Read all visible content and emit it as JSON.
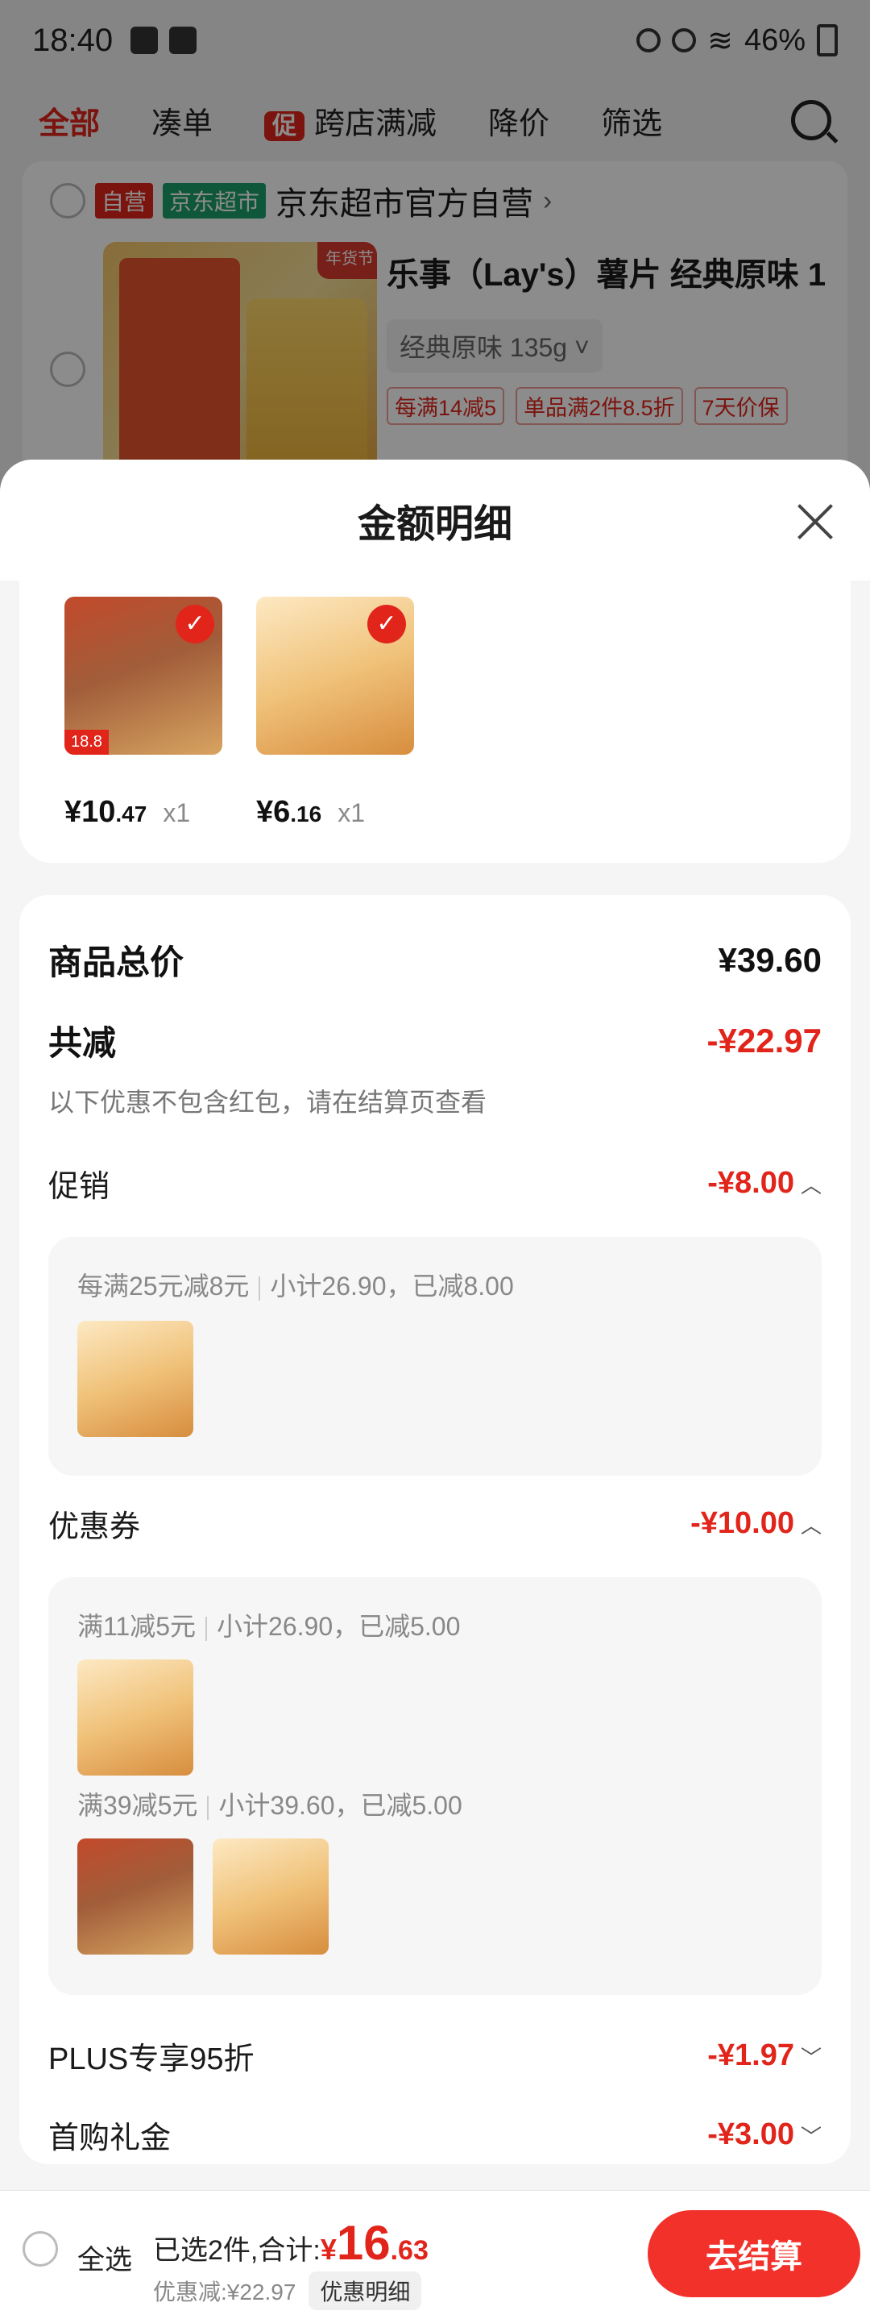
{
  "status_bar": {
    "time": "18:40",
    "battery": "46%"
  },
  "filter_bar": {
    "tabs": [
      "全部",
      "凑单",
      "跨店满减",
      "降价",
      "筛选"
    ],
    "promo_badge": "促"
  },
  "store": {
    "tag_self": "自营",
    "tag_market": "京东超市",
    "name": "京东超市官方自营",
    "chevron": "›"
  },
  "product": {
    "ribbon": "年货节",
    "title": "乐事（Lay's）薯片 经典原味 1",
    "spec": "经典原味 135g ˅",
    "chips": [
      "每满14减5",
      "单品满2件8.5折",
      "7天价保"
    ]
  },
  "sheet": {
    "title": "金额明细"
  },
  "items": [
    {
      "price_int": "¥10",
      "price_dec": ".47",
      "qty": "x1"
    },
    {
      "price_int": "¥6",
      "price_dec": ".16",
      "qty": "x1"
    }
  ],
  "summary": {
    "total_label": "商品总价",
    "total_value": "¥39.60",
    "reduce_label": "共减",
    "reduce_value": "-¥22.97",
    "note": "以下优惠不包含红包，请在结算页查看",
    "promo_label": "促销",
    "promo_value": "-¥8.00",
    "promo_rule": "每满25元减8元",
    "promo_sub": "小计26.90，已减8.00",
    "coupon_label": "优惠券",
    "coupon_value": "-¥10.00",
    "coupon1_rule": "满11减5元",
    "coupon1_sub": "小计26.90，已减5.00",
    "coupon2_rule": "满39减5元",
    "coupon2_sub": "小计39.60，已减5.00",
    "plus_label": "PLUS专享95折",
    "plus_value": "-¥1.97",
    "first_label": "首购礼金",
    "first_value": "-¥3.00"
  },
  "bottom": {
    "select_all": "全选",
    "selected_text": "已选2件,合计:",
    "yen": "¥",
    "total_int": "16",
    "total_dec": ".63",
    "saved": "优惠减:¥22.97",
    "detail_btn": "优惠明细",
    "checkout": "去结算"
  }
}
